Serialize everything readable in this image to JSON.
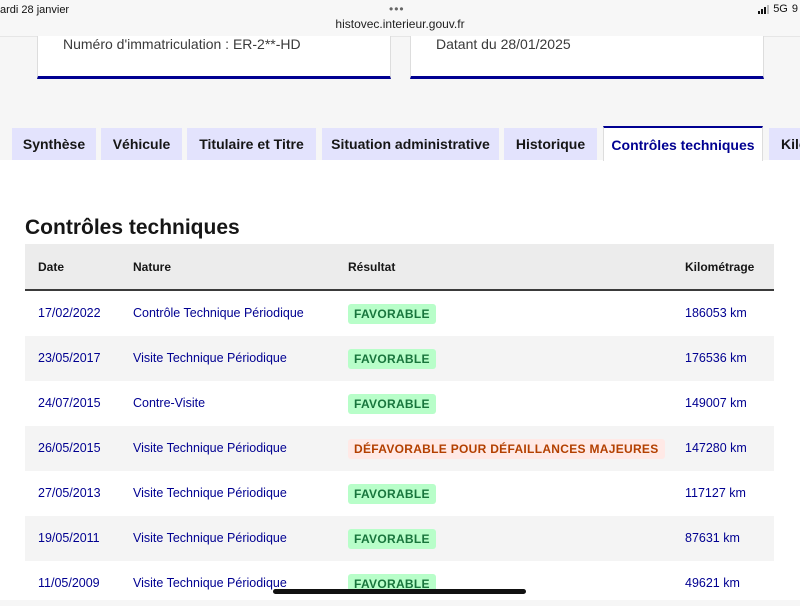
{
  "status_bar": {
    "date": "ardi 28 janvier",
    "dots": "•••",
    "url": "histovec.interieur.gouv.fr",
    "network": "5G",
    "battery": "9"
  },
  "cards": [
    {
      "text": "Numéro d'immatriculation : ER-2**-HD"
    },
    {
      "text": "Datant du 28/01/2025"
    }
  ],
  "tabs": [
    {
      "label": "Synthèse",
      "active": false
    },
    {
      "label": "Véhicule",
      "active": false
    },
    {
      "label": "Titulaire et Titre",
      "active": false
    },
    {
      "label": "Situation administrative",
      "active": false
    },
    {
      "label": "Historique",
      "active": false
    },
    {
      "label": "Contrôles techniques",
      "active": true
    },
    {
      "label": "Kilo",
      "active": false
    }
  ],
  "section": {
    "title": "Contrôles techniques"
  },
  "table": {
    "headers": [
      "Date",
      "Nature",
      "Résultat",
      "Kilométrage"
    ],
    "rows": [
      {
        "date": "17/02/2022",
        "nature": "Contrôle Technique Périodique",
        "result": "FAVORABLE",
        "status": "ok",
        "km": "186053 km"
      },
      {
        "date": "23/05/2017",
        "nature": "Visite Technique Périodique",
        "result": "FAVORABLE",
        "status": "ok",
        "km": "176536 km"
      },
      {
        "date": "24/07/2015",
        "nature": "Contre-Visite",
        "result": "FAVORABLE",
        "status": "ok",
        "km": "149007 km"
      },
      {
        "date": "26/05/2015",
        "nature": "Visite Technique Périodique",
        "result": "DÉFAVORABLE POUR DÉFAILLANCES MAJEURES",
        "status": "ko",
        "km": "147280 km"
      },
      {
        "date": "27/05/2013",
        "nature": "Visite Technique Périodique",
        "result": "FAVORABLE",
        "status": "ok",
        "km": "117127 km"
      },
      {
        "date": "19/05/2011",
        "nature": "Visite Technique Périodique",
        "result": "FAVORABLE",
        "status": "ok",
        "km": "87631 km"
      },
      {
        "date": "11/05/2009",
        "nature": "Visite Technique Périodique",
        "result": "FAVORABLE",
        "status": "ok",
        "km": "49621 km"
      }
    ]
  },
  "colors": {
    "primary": "#000091",
    "tab_bg": "#e3e3fd",
    "success_bg": "#b8fec9",
    "success_text": "#18753c",
    "error_bg": "#ffe9e6",
    "error_text": "#b34000"
  }
}
